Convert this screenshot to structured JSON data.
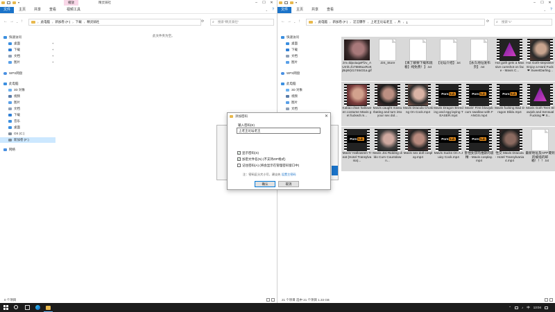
{
  "left_window": {
    "context_tab": "播放",
    "title": "精灵骑社",
    "ribbon_tabs": [
      "文件",
      "主页",
      "共享",
      "查看",
      "视频工具"
    ],
    "address": [
      "此电脑",
      "新加卷 (F:)",
      "下载",
      "精灵骑社"
    ],
    "search_placeholder": "搜索\"精灵骑社\"",
    "nav_items": [
      "快速访问",
      "桌面",
      "下载",
      "文档",
      "图片",
      "WPS网盘",
      "此电脑",
      "3D 对象",
      "视频",
      "图片",
      "文档",
      "下载",
      "音乐",
      "桌面",
      "OS (C:)",
      "新加卷 (F:)",
      "网络"
    ],
    "empty_text": "此文件夹为空。",
    "status": "0 个项目"
  },
  "right_window": {
    "ribbon_tabs": [
      "文件",
      "主页",
      "共享",
      "查看"
    ],
    "address": [
      "此电脑",
      "新加卷 (F:)",
      "涩涩爆存",
      "上老王论坛老王",
      "片",
      "1"
    ],
    "search_placeholder": "搜索\"1\"",
    "nav_items": [
      "快速访问",
      "桌面",
      "下载",
      "文档",
      "图片",
      "WPS网盘",
      "此电脑",
      "3D 对象",
      "视频",
      "图片",
      "文档",
      "下载",
      "音乐"
    ],
    "files": [
      {
        "name": "zm=ldpoiuqaFfzv_AUrnh=fo76M6uxRoKjBqW(41746431a.gif",
        "kind": "photo",
        "colors": [
          "#3a2b2b",
          "#a8797a",
          "#1a1010"
        ]
      },
      {
        "name": ".DS_Store",
        "kind": "doc"
      },
      {
        "name": "【来了解要下载和观看】纯免费！】.txt",
        "kind": "doc"
      },
      {
        "name": "【论坛介绍】.txt",
        "kind": "doc"
      },
      {
        "name": "【永久地址发布页】.txt",
        "kind": "doc"
      },
      {
        "name": "Hot goth gets a Massive cumshot on face - Mavis C...",
        "kind": "tri"
      },
      {
        "name": "Hot Goth-stepsister Enjoy a Hard Fuck ❤ SweetDarling...",
        "kind": "photo",
        "colors": [
          "#2a2a2a",
          "#c9a58f",
          "#5a3d34"
        ]
      },
      {
        "name": "Kakao chan halloween costume Mavis get fucked!.m...",
        "kind": "photo",
        "colors": [
          "#7a3c3c",
          "#d2a18d",
          "#3b2020"
        ]
      },
      {
        "name": "Mavis caught masturbating and turn into your sex dol...",
        "kind": "photo",
        "colors": [
          "#1d1d1d",
          "#bb8f82",
          "#4e3030"
        ]
      },
      {
        "name": "Mavis Dracula Choking On Cock.mp4",
        "kind": "photo",
        "colors": [
          "#2b2b2b",
          "#d9b3a5",
          "#8a5b4d"
        ]
      },
      {
        "name": "Mavis Dragon Breeding and egg laying TEASER.mp4",
        "kind": "ph"
      },
      {
        "name": "Mavis' First blowjob cum swallow with FANGS.mp4",
        "kind": "ph"
      },
      {
        "name": "Mavis fucking Bad Dragon Dildo.mp4",
        "kind": "ph"
      },
      {
        "name": "Mavis Goth Teen Blowjob and Sensual Fucking ❤ S...",
        "kind": "tri"
      },
      {
        "name": "Mavis' Halloween Treat (Hotel Transylvania)...",
        "kind": "ph"
      },
      {
        "name": "Mavis Jisi Ridding dildo Cum Countdown...",
        "kind": "photo",
        "colors": [
          "#3a3a3a",
          "#cfa9a0",
          "#222"
        ]
      },
      {
        "name": "Mavis sex doll cosplay.mp4",
        "kind": "photo",
        "colors": [
          "#242424",
          "#b88a7e",
          "#553636"
        ]
      },
      {
        "name": "Mavis Sucks On A Juicy Cock.mp4",
        "kind": "ph"
      },
      {
        "name": "害怕女孩玛维斯的吸精 - Mavis cosplay.mp4",
        "kind": "ph"
      },
      {
        "name": "性交 Mavis Dracula - Hotel Transylvania 4.mp4",
        "kind": "photo",
        "colors": [
          "#1f1f1f",
          "#8b6a60",
          "#3a2626"
        ]
      },
      {
        "name": "最新地址及APP遭到的被墙的邮箱！！！.txt",
        "kind": "doc"
      }
    ],
    "status": "21 个项目    选中 21 个项目  1.33 GB"
  },
  "dialog": {
    "title": "添加密码",
    "label": "输入密码(E)",
    "password_value": "上老王论坛老王",
    "options": [
      {
        "label": "显示密码(S)",
        "checked": true
      },
      {
        "label": "加密文件名(N) (不支持ZIP格式)",
        "checked": true
      },
      {
        "label": "记住密码(A) (将会显示在管理密码窗口中)",
        "checked": false
      }
    ],
    "note": "注：密码区分大小写，建议先",
    "note_link": "设置主密码",
    "ok": "确认",
    "cancel": "取消"
  },
  "taskbar": {
    "time": "13:04",
    "ime": "中"
  }
}
